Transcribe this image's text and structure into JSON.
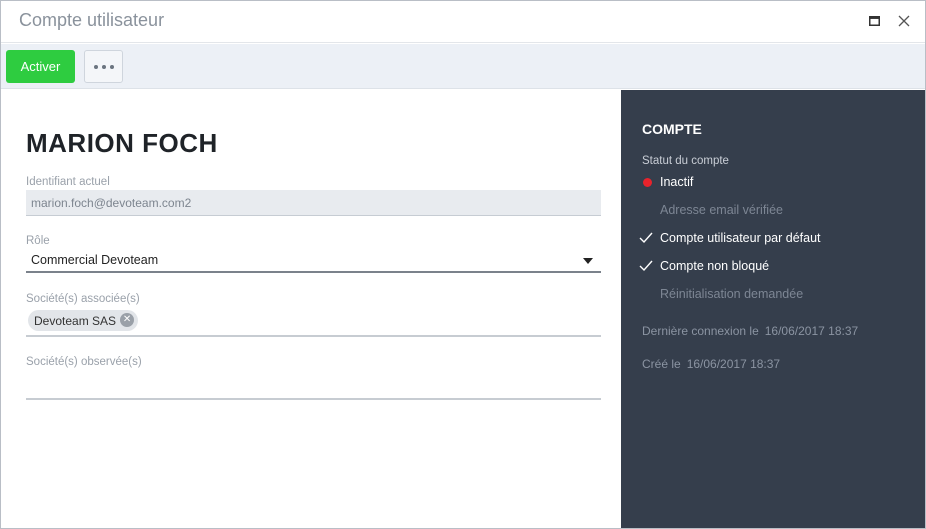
{
  "window": {
    "title": "Compte utilisateur",
    "maximize_icon": "maximize-icon",
    "close_icon": "close-icon"
  },
  "toolbar": {
    "activate_label": "Activer",
    "more_icon": "more-horizontal-icon"
  },
  "colors": {
    "accent_green": "#2ecc40",
    "sidebar_bg": "#353e4c",
    "status_red": "#e8232c"
  },
  "user": {
    "name": "MARION FOCH"
  },
  "form": {
    "identifier_label": "Identifiant actuel",
    "identifier_value": "marion.foch@devoteam.com2",
    "role_label": "Rôle",
    "role_value": "Commercial Devoteam",
    "companies_label": "Société(s) associée(s)",
    "companies": [
      "Devoteam SAS"
    ],
    "observed_label": "Société(s) observée(s)",
    "observed_value": ""
  },
  "account": {
    "title": "COMPTE",
    "status_label": "Statut du compte",
    "status_value": "Inactif",
    "flags": [
      {
        "label": "Adresse email vérifiée",
        "checked": false
      },
      {
        "label": "Compte utilisateur par défaut",
        "checked": true
      },
      {
        "label": "Compte non bloqué",
        "checked": true
      },
      {
        "label": "Réinitialisation demandée",
        "checked": false
      }
    ],
    "last_login_label": "Dernière connexion le",
    "last_login_value": "16/06/2017 18:37",
    "created_label": "Créé le",
    "created_value": "16/06/2017 18:37"
  }
}
